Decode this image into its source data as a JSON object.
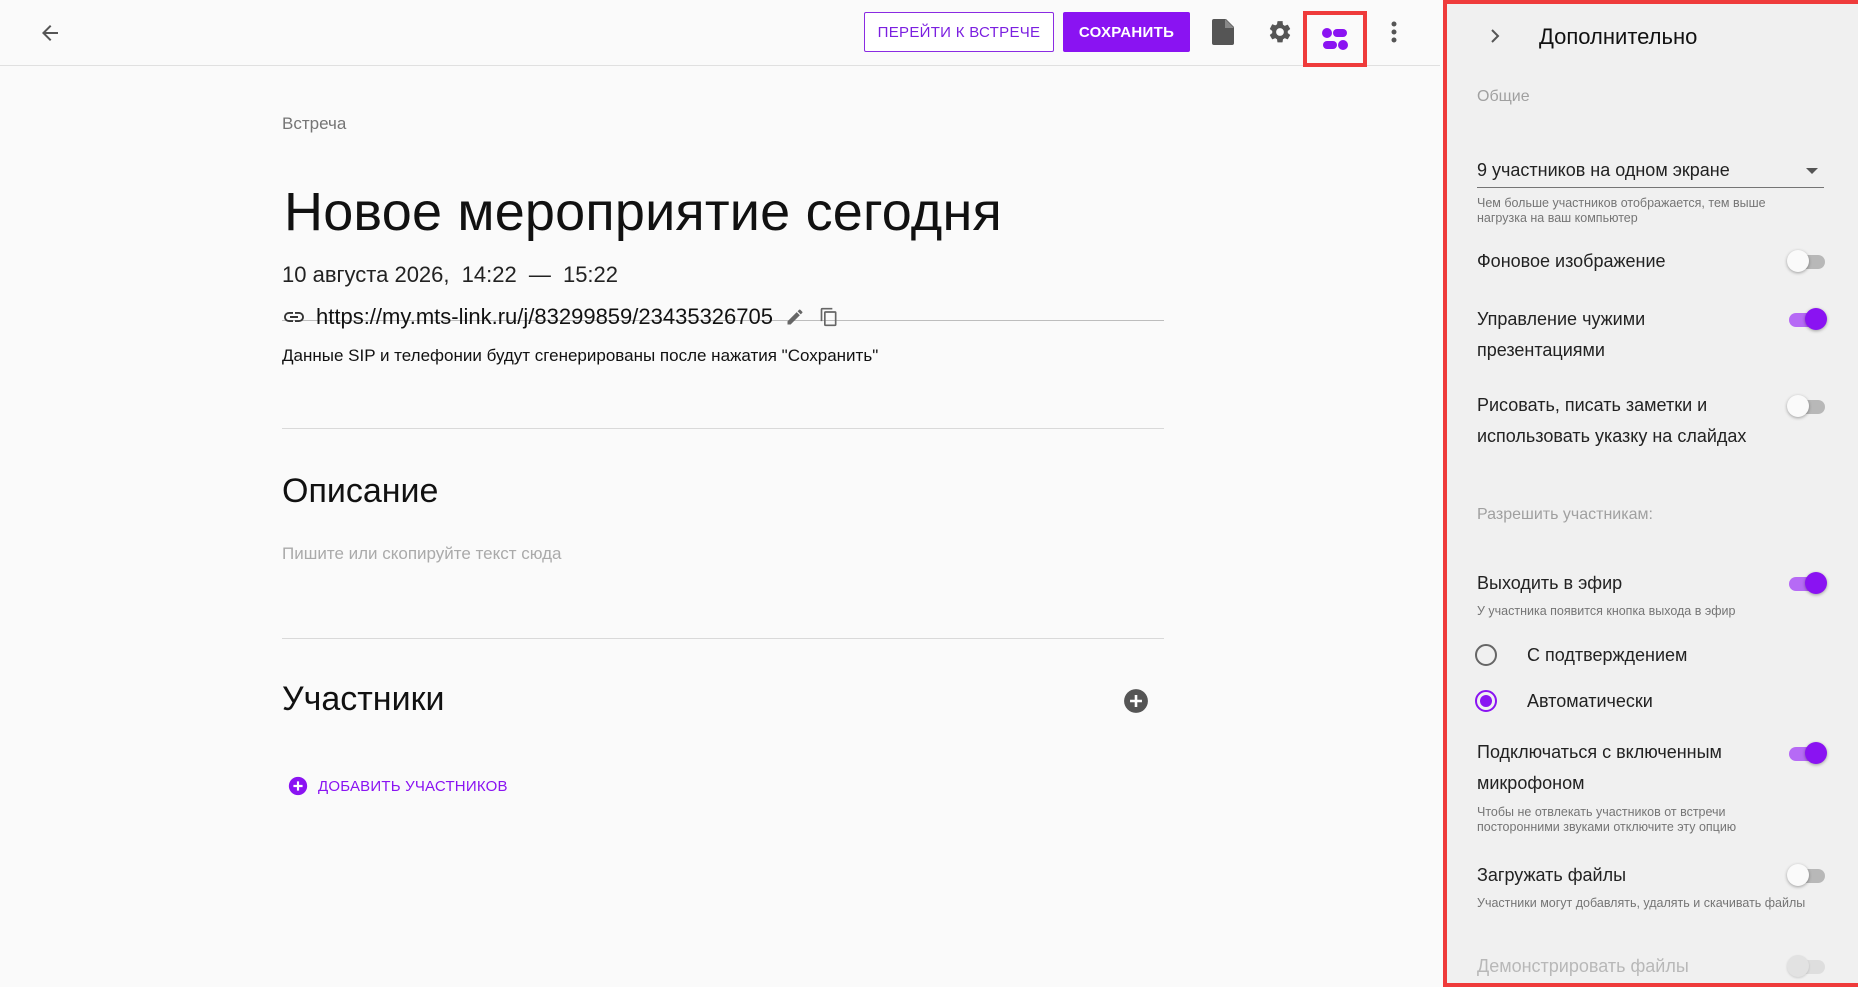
{
  "toolbar": {
    "go_to_meeting": "ПЕРЕЙТИ К ВСТРЕЧЕ",
    "save": "СОХРАНИТЬ"
  },
  "event": {
    "kind": "Встреча",
    "title": "Новое мероприятие сегодня",
    "date": "10 августа 2026,",
    "time_start": "14:22",
    "time_sep": "—",
    "time_end": "15:22",
    "link": "https://my.mts-link.ru/j/83299859/23435326705",
    "sip_note": "Данные SIP и телефонии будут сгенерированы после нажатия \"Сохранить\""
  },
  "description": {
    "title": "Описание",
    "placeholder": "Пишите или скопируйте текст сюда"
  },
  "participants": {
    "title": "Участники",
    "add_label": "ДОБАВИТЬ УЧАСТНИКОВ"
  },
  "panel": {
    "title": "Дополнительно",
    "general_label": "Общие",
    "screen_select": "9 участников на одном экране",
    "screen_hint": "Чем больше участников отображается, тем выше нагрузка на ваш компьютер",
    "bg_image": "Фоновое изображение",
    "manage_presentations": "Управление чужими презентациями",
    "draw_notes": "Рисовать, писать заметки и использовать указку на слайдах",
    "allow_label": "Разрешить участникам:",
    "go_on_air": "Выходить в эфир",
    "go_on_air_hint": "У участника появится кнопка выхода в эфир",
    "radio_confirm": "С подтверждением",
    "radio_auto": "Автоматически",
    "join_mic": "Подключаться с включенным микрофоном",
    "join_mic_hint": "Чтобы не отвлекать участников от встречи посторонними звуками отключите эту опцию",
    "upload_files": "Загружать файлы",
    "upload_files_hint": "Участники могут добавлять, удалять и скачивать файлы",
    "show_files": "Демонстрировать файлы"
  },
  "colors": {
    "accent": "#8a13f2",
    "highlight_border": "#ef3b3b"
  }
}
